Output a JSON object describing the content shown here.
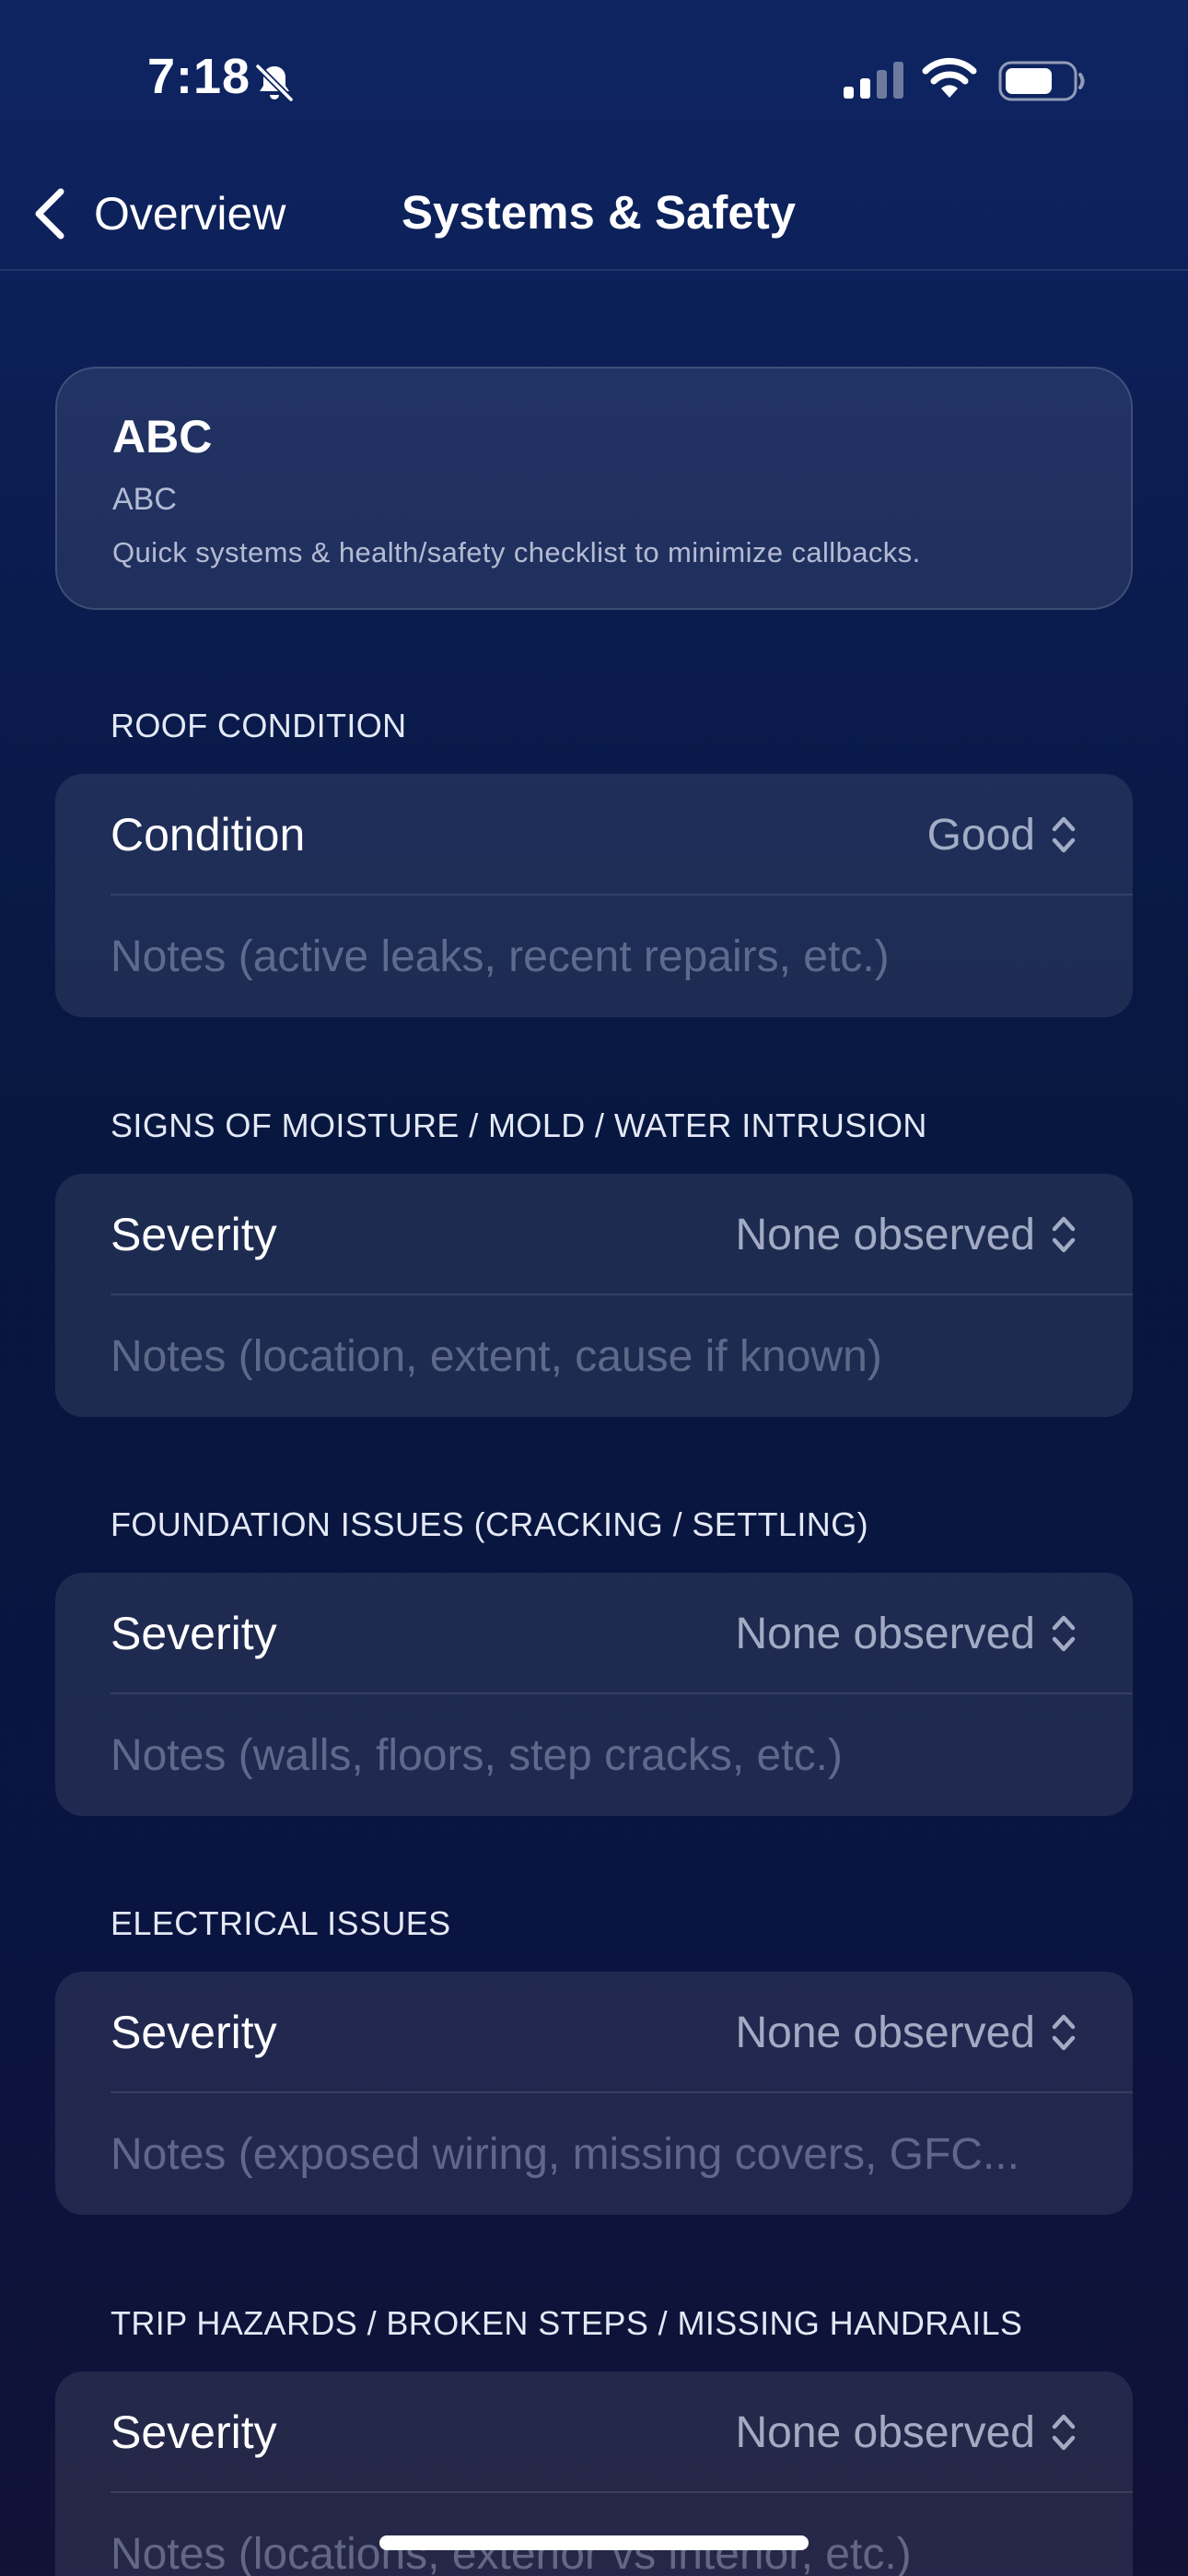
{
  "status_bar": {
    "time": "7:18",
    "icons": [
      "bell-slash-icon",
      "cellular-signal-icon",
      "wifi-icon",
      "battery-icon"
    ]
  },
  "nav": {
    "back_label": "Overview",
    "title": "Systems & Safety"
  },
  "summary": {
    "title": "ABC",
    "subtitle": "ABC",
    "description": "Quick systems & health/safety checklist to minimize callbacks."
  },
  "sections": [
    {
      "header": "ROOF CONDITION",
      "picker_label": "Condition",
      "picker_value": "Good",
      "notes_placeholder": "Notes (active leaks, recent repairs, etc.)",
      "notes_value": ""
    },
    {
      "header": "SIGNS OF MOISTURE / MOLD / WATER INTRUSION",
      "picker_label": "Severity",
      "picker_value": "None observed",
      "notes_placeholder": "Notes (location, extent, cause if known)",
      "notes_value": ""
    },
    {
      "header": "FOUNDATION ISSUES (CRACKING / SETTLING)",
      "picker_label": "Severity",
      "picker_value": "None observed",
      "notes_placeholder": "Notes (walls, floors, step cracks, etc.)",
      "notes_value": ""
    },
    {
      "header": "ELECTRICAL ISSUES",
      "picker_label": "Severity",
      "picker_value": "None observed",
      "notes_placeholder": "Notes (exposed wiring, missing covers, GFC...",
      "notes_value": ""
    },
    {
      "header": "TRIP HAZARDS / BROKEN STEPS / MISSING HANDRAILS",
      "picker_label": "Severity",
      "picker_value": "None observed",
      "notes_placeholder": "Notes (locations, exterior vs interior, etc.)",
      "notes_value": ""
    }
  ],
  "colors": {
    "background_top": "#0f2563",
    "background_bottom": "#111236",
    "card_fill": "rgba(255,255,255,0.09)"
  }
}
